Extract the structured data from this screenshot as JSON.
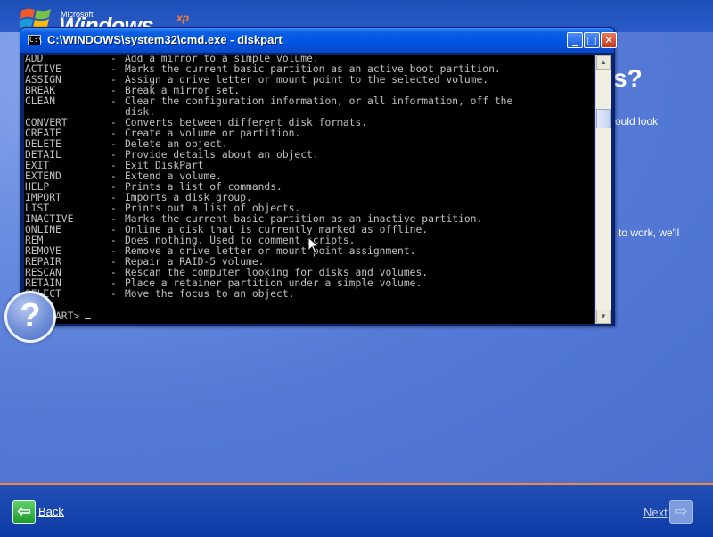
{
  "logo": {
    "brand": "Microsoft",
    "product": "Windows",
    "edition": "xp"
  },
  "page": {
    "heading_fragment": "s?",
    "text_fragment_1": "ould look",
    "text_fragment_2": "to work, we'll"
  },
  "cmd": {
    "title": "C:\\WINDOWS\\system32\\cmd.exe - diskpart",
    "icon_text": "C:\\",
    "min_glyph": "_",
    "max_glyph": "□",
    "close_glyph": "✕",
    "lines": [
      {
        "cmd": "ADD",
        "desc": "Add a mirror to a simple volume."
      },
      {
        "cmd": "ACTIVE",
        "desc": "Marks the current basic partition as an active boot partition."
      },
      {
        "cmd": "ASSIGN",
        "desc": "Assign a drive letter or mount point to the selected volume."
      },
      {
        "cmd": "BREAK",
        "desc": "Break a mirror set."
      },
      {
        "cmd": "CLEAN",
        "desc": "Clear the configuration information, or all information, off the"
      },
      {
        "cmd": "",
        "desc": "disk."
      },
      {
        "cmd": "CONVERT",
        "desc": "Converts between different disk formats."
      },
      {
        "cmd": "CREATE",
        "desc": "Create a volume or partition."
      },
      {
        "cmd": "DELETE",
        "desc": "Delete an object."
      },
      {
        "cmd": "DETAIL",
        "desc": "Provide details about an object."
      },
      {
        "cmd": "EXIT",
        "desc": "Exit DiskPart"
      },
      {
        "cmd": "EXTEND",
        "desc": "Extend a volume."
      },
      {
        "cmd": "HELP",
        "desc": "Prints a list of commands."
      },
      {
        "cmd": "IMPORT",
        "desc": "Imports a disk group."
      },
      {
        "cmd": "LIST",
        "desc": "Prints out a list of objects."
      },
      {
        "cmd": "INACTIVE",
        "desc": "Marks the current basic partition as an inactive partition."
      },
      {
        "cmd": "ONLINE",
        "desc": "Online a disk that is currently marked as offline."
      },
      {
        "cmd": "REM",
        "desc": "Does nothing. Used to comment scripts."
      },
      {
        "cmd": "REMOVE",
        "desc": "Remove a drive letter or mount point assignment."
      },
      {
        "cmd": "REPAIR",
        "desc": "Repair a RAID-5 volume."
      },
      {
        "cmd": "RESCAN",
        "desc": "Rescan the computer looking for disks and volumes."
      },
      {
        "cmd": "RETAIN",
        "desc": "Place a retainer partition under a simple volume."
      },
      {
        "cmd": "SELECT",
        "desc": "Move the focus to an object."
      }
    ],
    "prompt": "DISKPART>"
  },
  "help": {
    "glyph": "?"
  },
  "nav": {
    "back_label": "Back",
    "next_label": "Next",
    "back_glyph": "⇦",
    "next_glyph": "⇨"
  },
  "colors": {
    "console_bg": "#000000",
    "console_text": "#c0c0c0",
    "titlebar": "#0054e3",
    "accent_orange": "#e98a3e",
    "background_blue": "#5a7edc"
  }
}
